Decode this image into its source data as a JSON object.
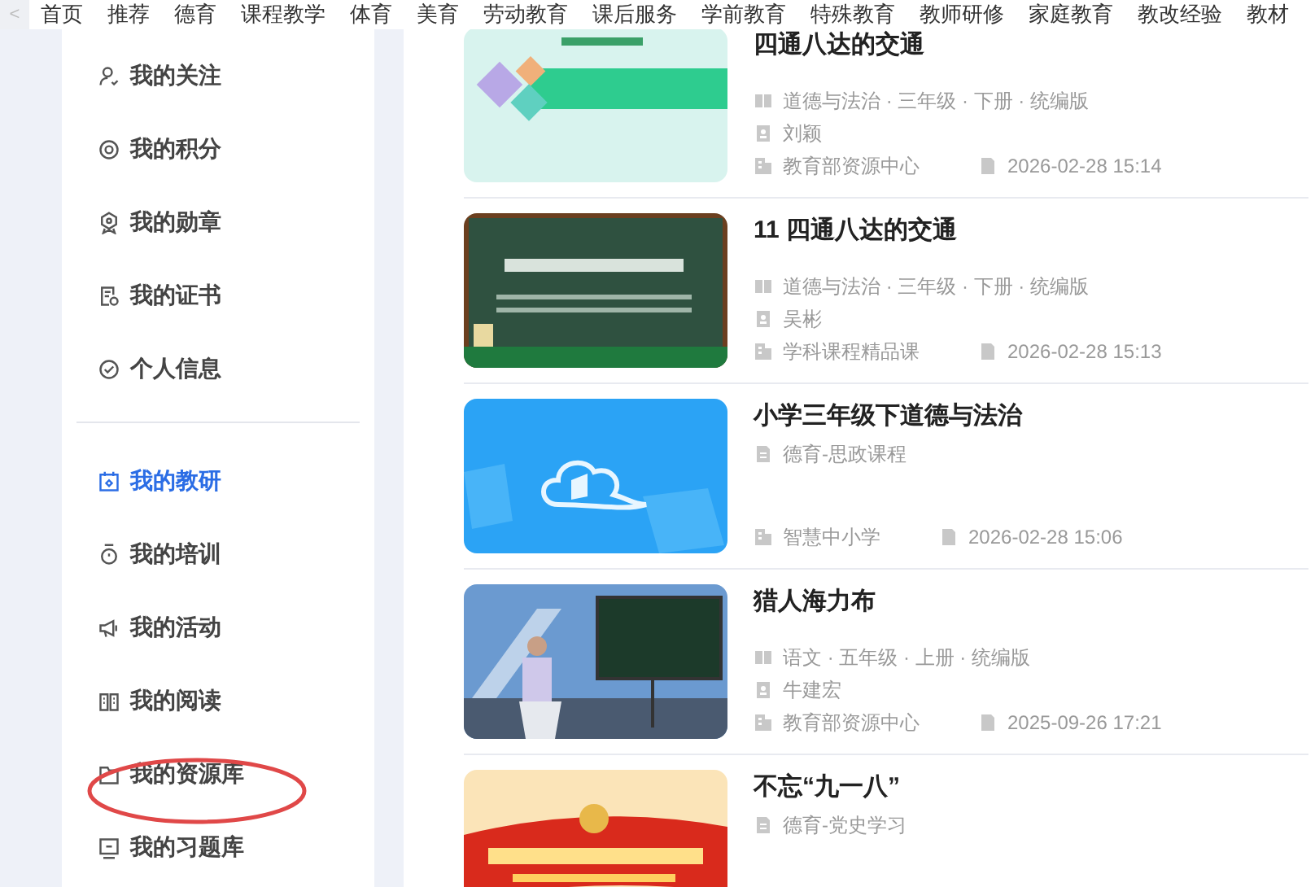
{
  "nav": {
    "back": "<",
    "items": [
      "首页",
      "推荐",
      "德育",
      "课程教学",
      "体育",
      "美育",
      "劳动教育",
      "课后服务",
      "学前教育",
      "特殊教育",
      "教师研修",
      "家庭教育",
      "教改经验",
      "教材"
    ]
  },
  "sidebar": {
    "groups": [
      [
        {
          "label": "我的关注",
          "selected": false,
          "circled": false
        },
        {
          "label": "我的积分",
          "selected": false,
          "circled": false
        },
        {
          "label": "我的勋章",
          "selected": false,
          "circled": false
        },
        {
          "label": "我的证书",
          "selected": false,
          "circled": false
        },
        {
          "label": "个人信息",
          "selected": false,
          "circled": false
        }
      ],
      [
        {
          "label": "我的教研",
          "selected": true,
          "circled": false
        },
        {
          "label": "我的培训",
          "selected": false,
          "circled": false
        },
        {
          "label": "我的活动",
          "selected": false,
          "circled": false
        },
        {
          "label": "我的阅读",
          "selected": false,
          "circled": false
        },
        {
          "label": "我的资源库",
          "selected": false,
          "circled": true
        },
        {
          "label": "我的习题库",
          "selected": false,
          "circled": false
        }
      ]
    ]
  },
  "resources": [
    {
      "title": "四通八达的交通",
      "subject": "道德与法治 · 三年级 · 下册 · 统编版",
      "author": "刘颖",
      "source": "教育部资源中心",
      "date": "2026-02-28 15:14"
    },
    {
      "title": "11 四通八达的交通",
      "subject": "道德与法治 · 三年级 · 下册 · 统编版",
      "author": "吴彬",
      "source": "学科课程精品课",
      "date": "2026-02-28 15:13"
    },
    {
      "title": "小学三年级下道德与法治",
      "category": "德育-思政课程",
      "source": "智慧中小学",
      "date": "2026-02-28 15:06"
    },
    {
      "title": "猎人海力布",
      "subject": "语文 · 五年级 · 上册 · 统编版",
      "author": "牛建宏",
      "source": "教育部资源中心",
      "date": "2025-09-26 17:21"
    },
    {
      "title": "不忘“九一八”",
      "category": "德育-党史学习"
    }
  ]
}
